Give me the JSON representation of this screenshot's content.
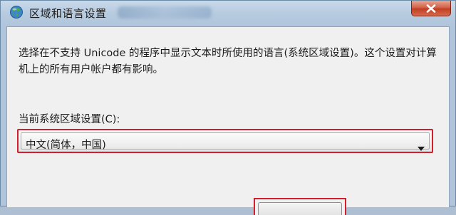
{
  "window": {
    "title": "区域和语言设置"
  },
  "dialog": {
    "description": "选择在不支持 Unicode 的程序中显示文本时所使用的语言(系统区域设置)。这个设置对计算机上的所有用户帐户都有影响。",
    "current_locale_label": "当前系统区域设置(C):",
    "current_locale_value": "中文(简体，中国)"
  },
  "icons": {
    "title": "globe-icon",
    "close": "close-icon",
    "dropdown": "dropdown-arrow-icon"
  },
  "colors": {
    "highlight": "#d21f2b",
    "close_button": "#c8482d",
    "dialog_background": "#f0f0f0",
    "window_frame": "#b7cbe0"
  }
}
